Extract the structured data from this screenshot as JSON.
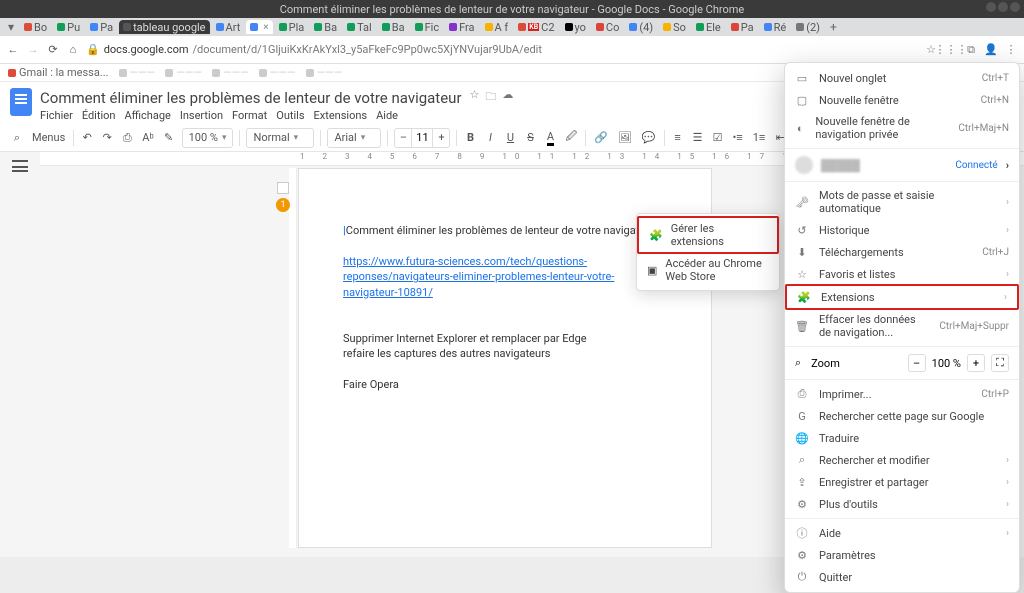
{
  "window": {
    "title": "Comment éliminer les problèmes de lenteur de votre navigateur - Google Docs - Google Chrome"
  },
  "tabs": [
    {
      "label": "Bo",
      "fav": "#dd4b39"
    },
    {
      "label": "Pu",
      "fav": "#0f9d58"
    },
    {
      "label": "Pa",
      "fav": "#4285f4"
    },
    {
      "label": "tableau google",
      "fav": "#555",
      "dark": true
    },
    {
      "label": "Art",
      "fav": "#4285f4"
    },
    {
      "label": "",
      "fav": "#4285f4",
      "active": true
    },
    {
      "label": "Pla",
      "fav": "#0f9d58"
    },
    {
      "label": "Ba",
      "fav": "#0f9d58"
    },
    {
      "label": "Tal",
      "fav": "#0f9d58"
    },
    {
      "label": "Ba",
      "fav": "#0f9d58"
    },
    {
      "label": "Fic",
      "fav": "#0f9d58"
    },
    {
      "label": "Fra",
      "fav": "#8430ce"
    },
    {
      "label": "A f",
      "fav": "#f4b400"
    },
    {
      "label": "C2",
      "fav": "#dd4b39",
      "kb": true
    },
    {
      "label": "yo",
      "fav": "#000"
    },
    {
      "label": "Co",
      "fav": "#db4437"
    },
    {
      "label": "(4)",
      "fav": "#4285f4"
    },
    {
      "label": "So",
      "fav": "#f4b400"
    },
    {
      "label": "Ele",
      "fav": "#0f9d58"
    },
    {
      "label": "Pa",
      "fav": "#db4437"
    },
    {
      "label": "Ré",
      "fav": "#4285f4"
    },
    {
      "label": "(2)",
      "fav": "#777"
    }
  ],
  "address": {
    "host": "docs.google.com",
    "path": "/document/d/1GljuiKxKrAkYxl3_y5aFkeFc9Pp0wc5XjYNVujar9UbA/edit"
  },
  "bookmarks": [
    {
      "label": "Gmail : la messa..."
    }
  ],
  "doc": {
    "title": "Comment éliminer les problèmes de lenteur de votre navigateur",
    "menus": [
      "Fichier",
      "Édition",
      "Affichage",
      "Insertion",
      "Format",
      "Outils",
      "Extensions",
      "Aide"
    ]
  },
  "toolbar": {
    "search": "⌕",
    "menus": "Menus",
    "undo": "↶",
    "redo": "↷",
    "print": "⎙",
    "spell": "Aᵇ",
    "paint": "✎",
    "zoom": "100 %",
    "style": "Normal",
    "font": "Arial",
    "minus": "–",
    "fontsize": "11",
    "plus": "+",
    "bold": "B",
    "italic": "I",
    "underline": "U",
    "strike": "S",
    "color": "A"
  },
  "page": {
    "heading": "Comment éliminer les problèmes de lenteur de votre navigateur ?",
    "link": "https://www.futura-sciences.com/tech/questions-reponses/navigateurs-eliminer-problemes-lenteur-votre-navigateur-10891/",
    "p1": "Supprimer Internet Explorer et remplacer par Edge",
    "p2": "refaire les captures des autres navigateurs",
    "p3": "Faire Opera",
    "badge": "1"
  },
  "submenu": {
    "manage": "Gérer les extensions",
    "store": "Accéder au Chrome Web Store"
  },
  "menu": {
    "new_tab": {
      "label": "Nouvel onglet",
      "sc": "Ctrl+T"
    },
    "new_win": {
      "label": "Nouvelle fenêtre",
      "sc": "Ctrl+N"
    },
    "incognito": {
      "label": "Nouvelle fenêtre de navigation privée",
      "sc": "Ctrl+Maj+N"
    },
    "connected": "Connecté",
    "passwords": "Mots de passe et saisie automatique",
    "history": "Historique",
    "downloads": {
      "label": "Téléchargements",
      "sc": "Ctrl+J"
    },
    "favorites": "Favoris et listes",
    "extensions": "Extensions",
    "clear": {
      "label": "Effacer les données de navigation...",
      "sc": "Ctrl+Maj+Suppr"
    },
    "zoom": {
      "label": "Zoom",
      "value": "100 %"
    },
    "print": {
      "label": "Imprimer...",
      "sc": "Ctrl+P"
    },
    "search_page": "Rechercher cette page sur Google",
    "translate": "Traduire",
    "find_edit": "Rechercher et modifier",
    "save_share": "Enregistrer et partager",
    "more_tools": "Plus d'outils",
    "help": "Aide",
    "settings": "Paramètres",
    "quit": "Quitter"
  }
}
